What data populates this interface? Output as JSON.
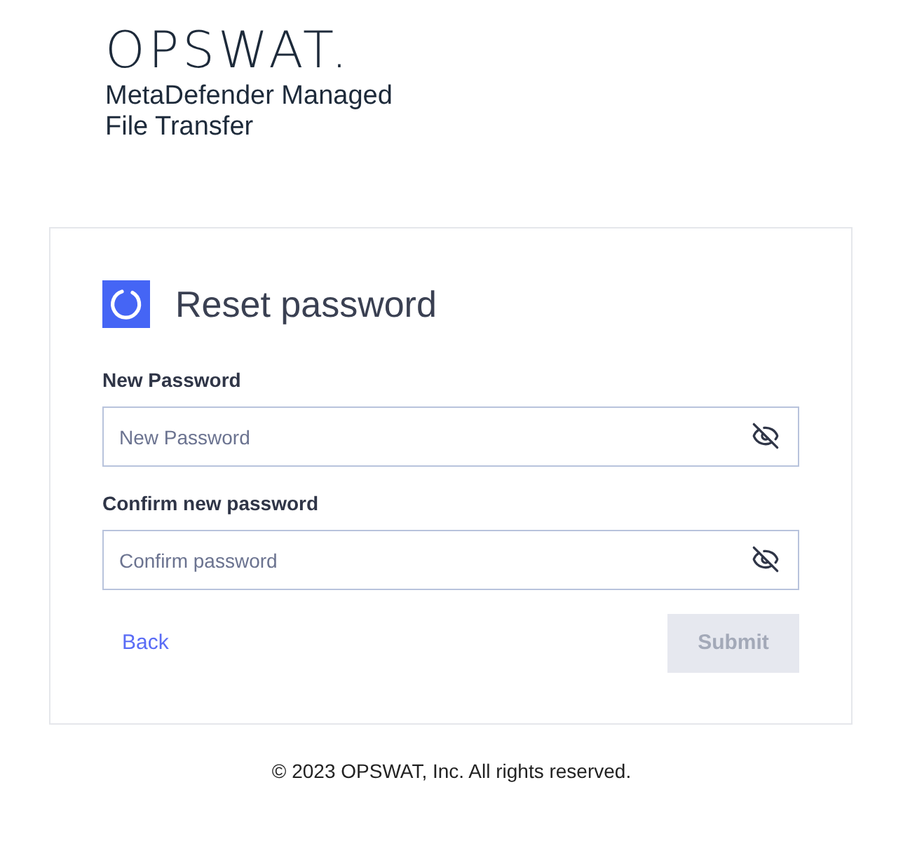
{
  "header": {
    "logo": "OPSWAT.",
    "product": "MetaDefender Managed File Transfer"
  },
  "card": {
    "title": "Reset password",
    "fields": [
      {
        "label": "New Password",
        "placeholder": "New Password",
        "password_visible": false
      },
      {
        "label": "Confirm new password",
        "placeholder": "Confirm password",
        "password_visible": false
      }
    ],
    "back_link": "Back",
    "submit": {
      "label": "Submit",
      "disabled": true
    }
  },
  "footer": "© 2023 OPSWAT, Inc. All rights reserved."
}
